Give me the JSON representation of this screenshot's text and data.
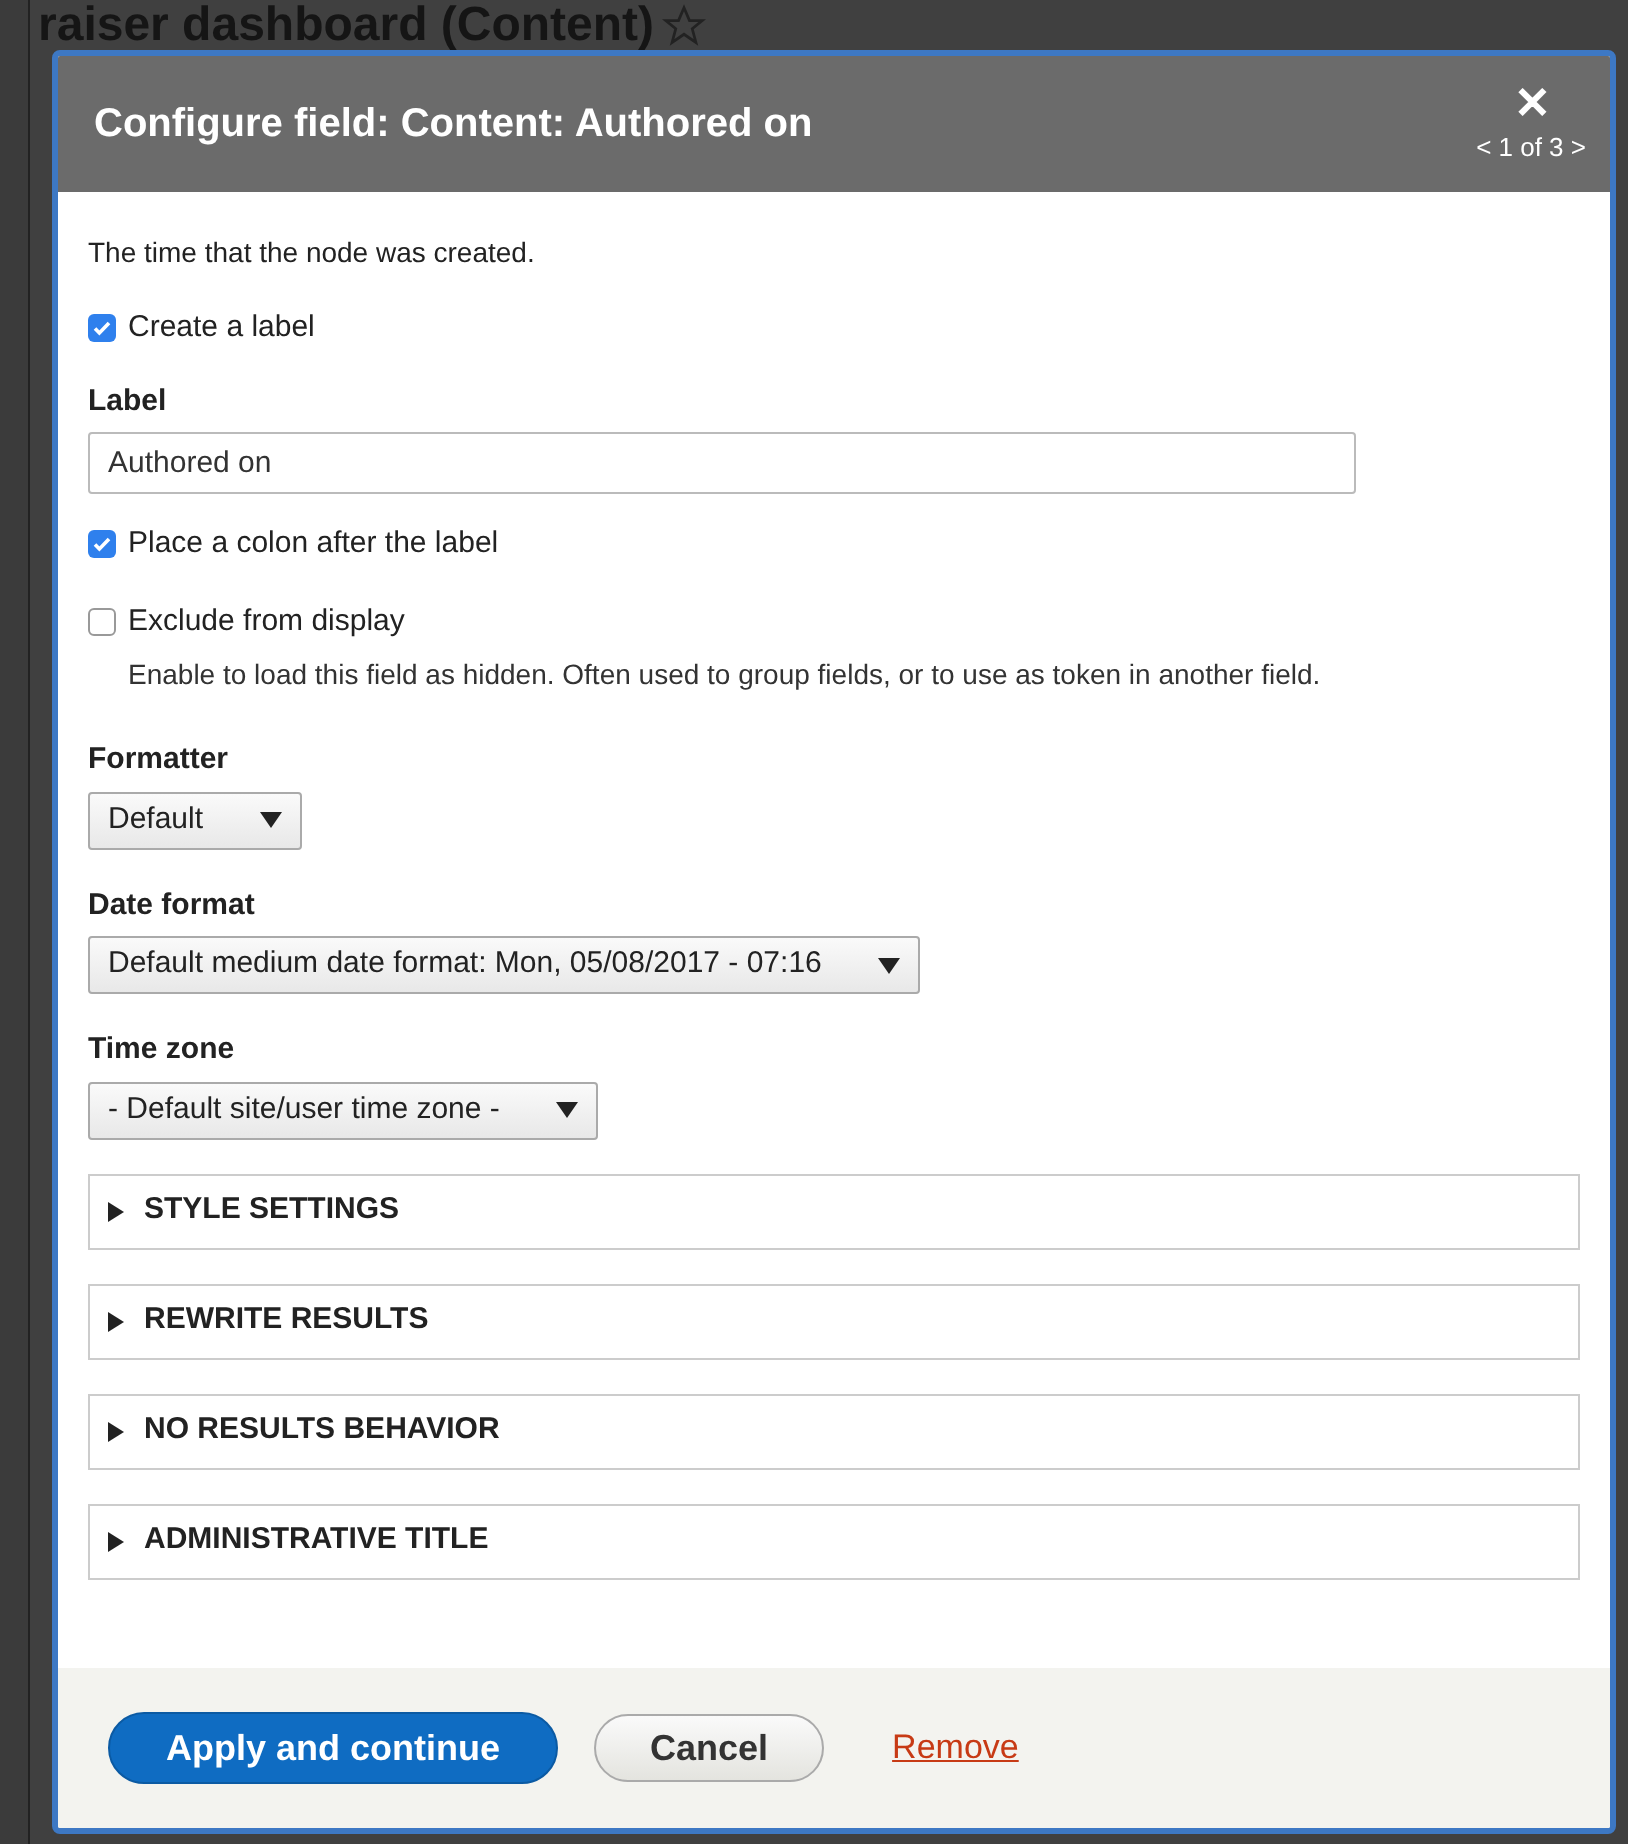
{
  "background": {
    "page_title": "raiser dashboard (Content)"
  },
  "dialog": {
    "title": "Configure field: Content: Authored on",
    "pager": "< 1 of 3 >",
    "close_glyph": "✕"
  },
  "description": "The time that the node was created.",
  "create_label": {
    "label": "Create a label",
    "checked": true
  },
  "label_field": {
    "label": "Label",
    "value": "Authored on"
  },
  "colon": {
    "label": "Place a colon after the label",
    "checked": true
  },
  "exclude": {
    "label": "Exclude from display",
    "checked": false,
    "help": "Enable to load this field as hidden. Often used to group fields, or to use as token in another field."
  },
  "selects": [
    {
      "label": "Formatter",
      "value": "Default"
    },
    {
      "label": "Date format",
      "value": "Default medium date format: Mon, 05/08/2017 - 07:16"
    },
    {
      "label": "Time zone",
      "value": "- Default site/user time zone -"
    }
  ],
  "sections": [
    {
      "title": "STYLE SETTINGS",
      "expanded": false
    },
    {
      "title": "REWRITE RESULTS",
      "expanded": false
    },
    {
      "title": "NO RESULTS BEHAVIOR",
      "expanded": false
    },
    {
      "title": "ADMINISTRATIVE TITLE",
      "expanded": false
    }
  ],
  "buttons": [
    {
      "label": "Apply and continue",
      "kind": "primary"
    },
    {
      "label": "Cancel",
      "kind": "secondary"
    },
    {
      "label": "Remove",
      "kind": "link"
    }
  ]
}
